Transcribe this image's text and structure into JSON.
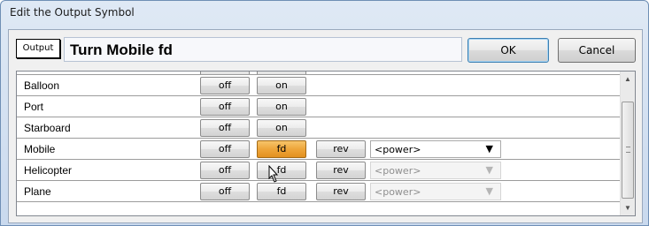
{
  "window": {
    "title": "Edit the Output Symbol"
  },
  "header": {
    "symbol_label": "Output",
    "symbol_name": "Turn Mobile fd",
    "ok_label": "OK",
    "cancel_label": "Cancel"
  },
  "rows": [
    {
      "label": "Balloon",
      "off": "off",
      "on": "on"
    },
    {
      "label": "Port",
      "off": "off",
      "on": "on"
    },
    {
      "label": "Starboard",
      "off": "off",
      "on": "on"
    },
    {
      "label": "Mobile",
      "off": "off",
      "fd": "fd",
      "rev": "rev",
      "power": "<power>"
    },
    {
      "label": "Helicopter",
      "off": "off",
      "fd": "fd",
      "rev": "rev",
      "power": "<power>"
    },
    {
      "label": "Plane",
      "off": "off",
      "fd": "fd",
      "rev": "rev",
      "power": "<power>"
    }
  ],
  "colors": {
    "active_button": "#eea53a",
    "window_frame": "#c9d9ee"
  },
  "icons": {
    "scroll_up": "scroll-up-arrow-icon",
    "scroll_down": "scroll-down-arrow-icon",
    "dropdown": "chevron-down-icon",
    "cursor": "mouse-pointer-icon"
  }
}
